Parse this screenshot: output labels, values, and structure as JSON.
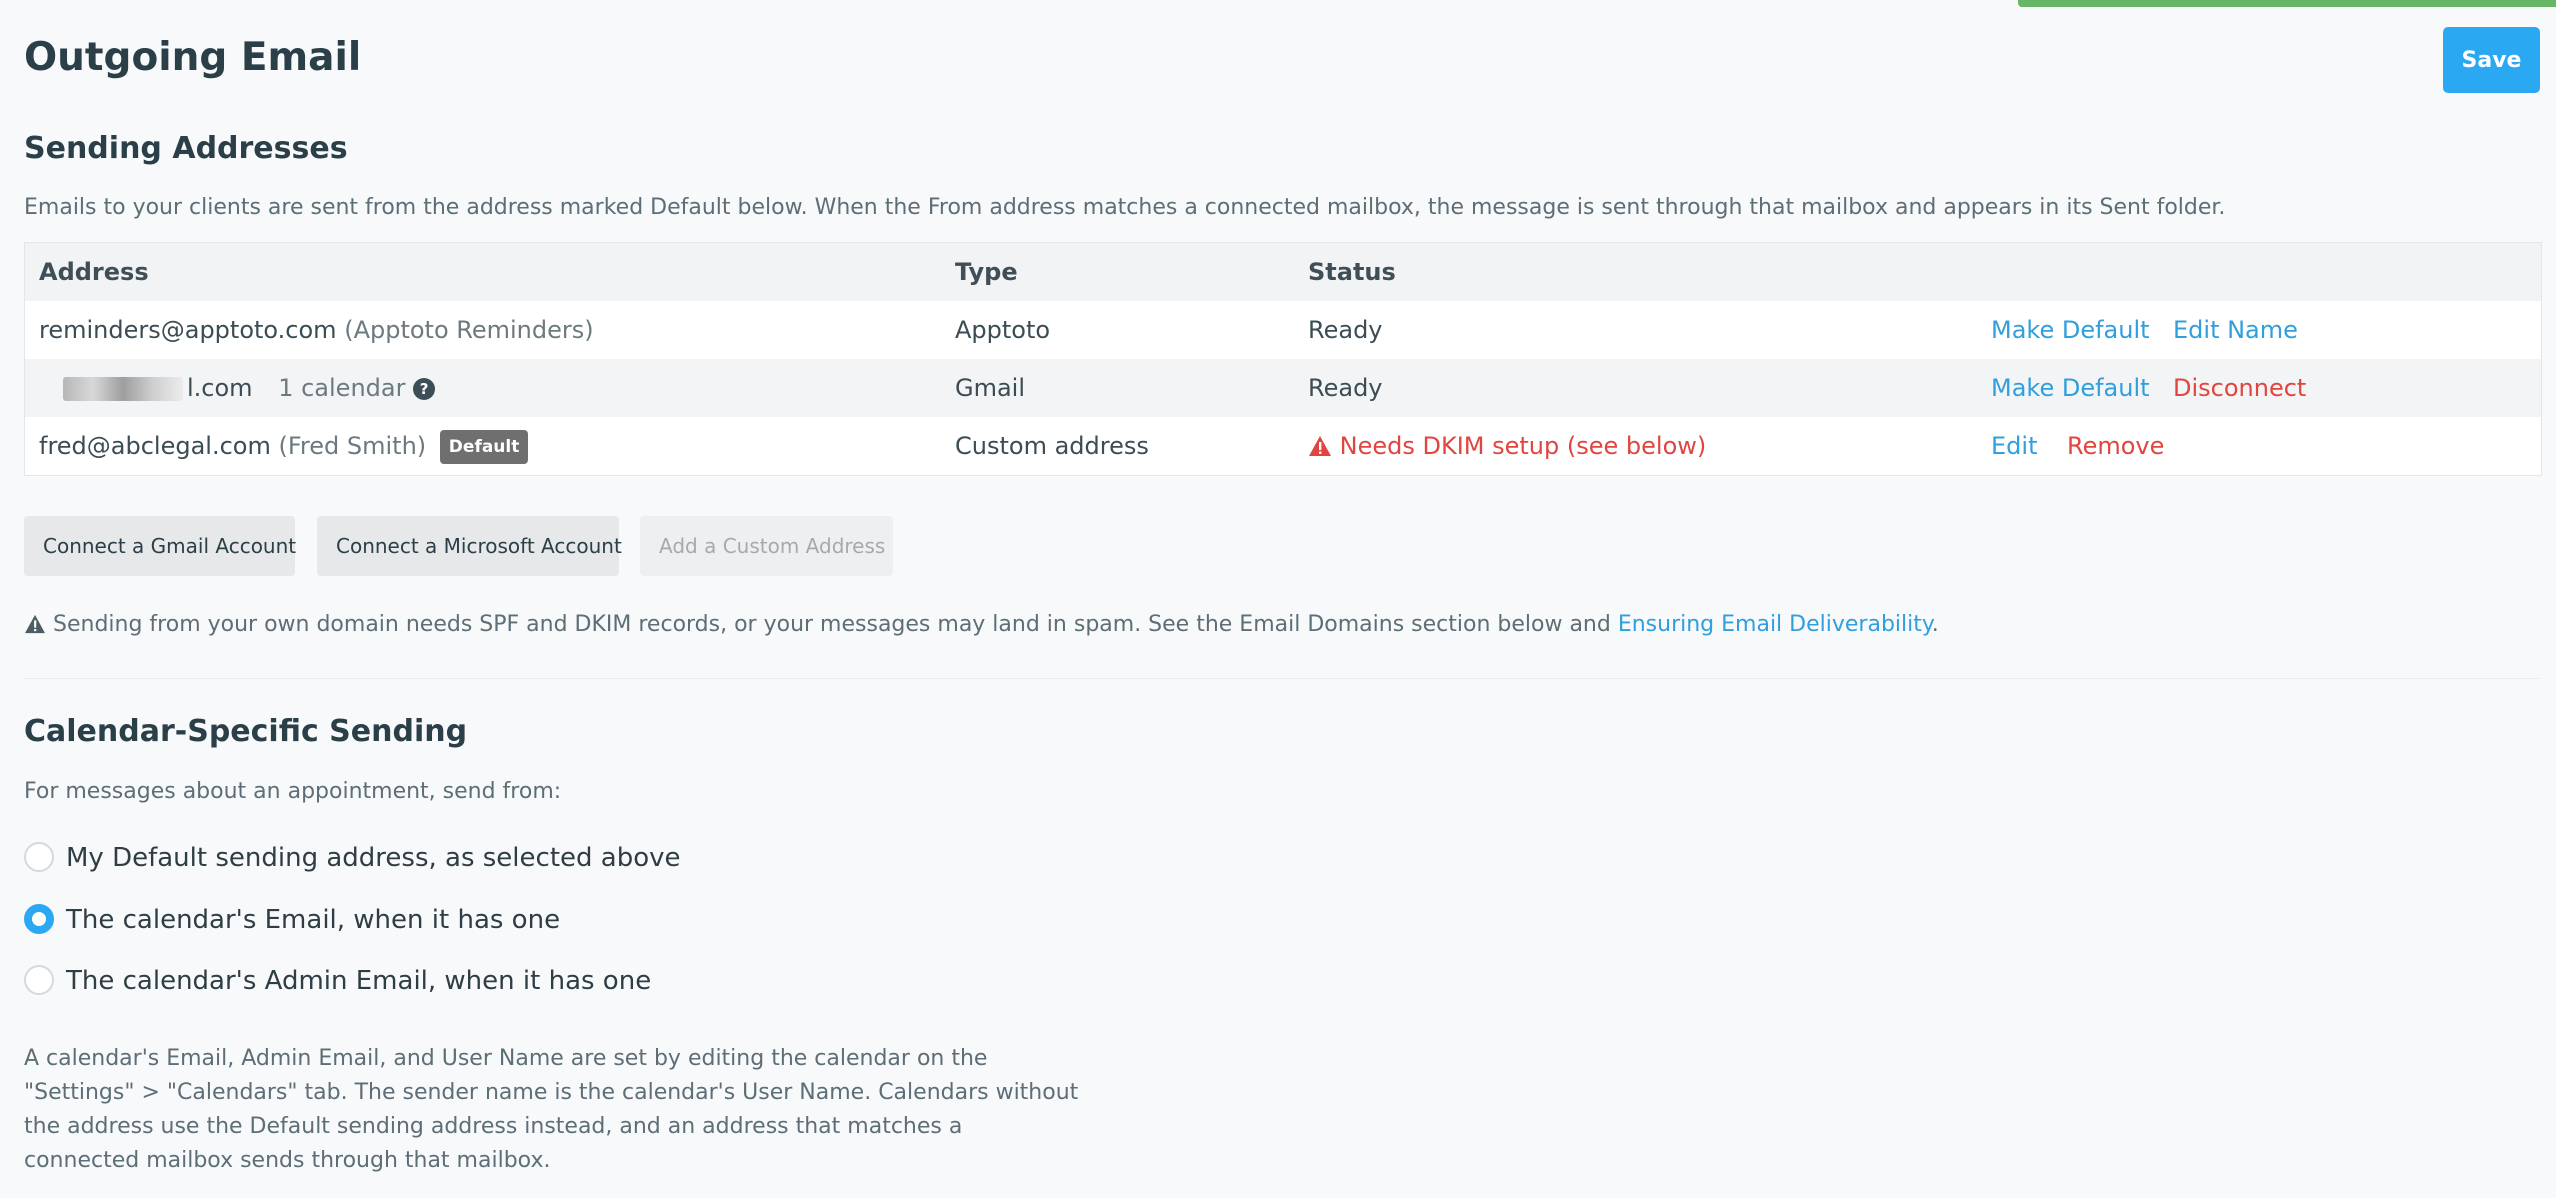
{
  "header": {
    "title": "Outgoing Email",
    "save_label": "Save"
  },
  "sending": {
    "heading": "Sending Addresses",
    "description": "Emails to your clients are sent from the address marked Default below. When the From address matches a connected mailbox, the message is sent through that mailbox and appears in its Sent folder.",
    "columns": [
      "Address",
      "Type",
      "Status"
    ],
    "rows": [
      {
        "address": "reminders@apptoto.com",
        "name": "(Apptoto Reminders)",
        "type": "Apptoto",
        "status": "Ready",
        "action1": "Make Default",
        "action2": "Edit Name"
      },
      {
        "address_suffix": "l.com",
        "calendars": "1 calendar",
        "type": "Gmail",
        "status": "Ready",
        "action1": "Make Default",
        "action2": "Disconnect"
      },
      {
        "address": "fred@abclegal.com",
        "name": "(Fred Smith)",
        "badge": "Default",
        "type": "Custom address",
        "status": "Needs DKIM setup (see below)",
        "action1": "Edit",
        "action2": "Remove"
      }
    ],
    "buttons": {
      "gmail": "Connect a Gmail Account",
      "microsoft": "Connect a Microsoft Account",
      "custom": "Add a Custom Address"
    },
    "warning_text": "Sending from your own domain needs SPF and DKIM records, or your messages may land in spam. See the Email Domains section below and ",
    "warning_link": "Ensuring Email Deliverability",
    "warning_end": "."
  },
  "calendar": {
    "heading": "Calendar-Specific Sending",
    "prompt": "For messages about an appointment, send from:",
    "options": [
      {
        "label": "My Default sending address, as selected above",
        "checked": false
      },
      {
        "label": "The calendar's Email, when it has one",
        "checked": true
      },
      {
        "label": "The calendar's Admin Email, when it has one",
        "checked": false
      }
    ],
    "note": "A calendar's Email, Admin Email, and User Name are set by editing the calendar on the \"Settings\" > \"Calendars\" tab. The sender name is the calendar's User Name. Calendars without the address use the Default sending address instead, and an address that matches a connected mailbox sends through that mailbox."
  },
  "colors": {
    "accent": "#2aa8f2",
    "link": "#2f9fde",
    "danger": "#e0453f",
    "toast": "#67b667"
  },
  "icons": {
    "question": "question-circle-icon",
    "warning": "warning-triangle-icon"
  }
}
